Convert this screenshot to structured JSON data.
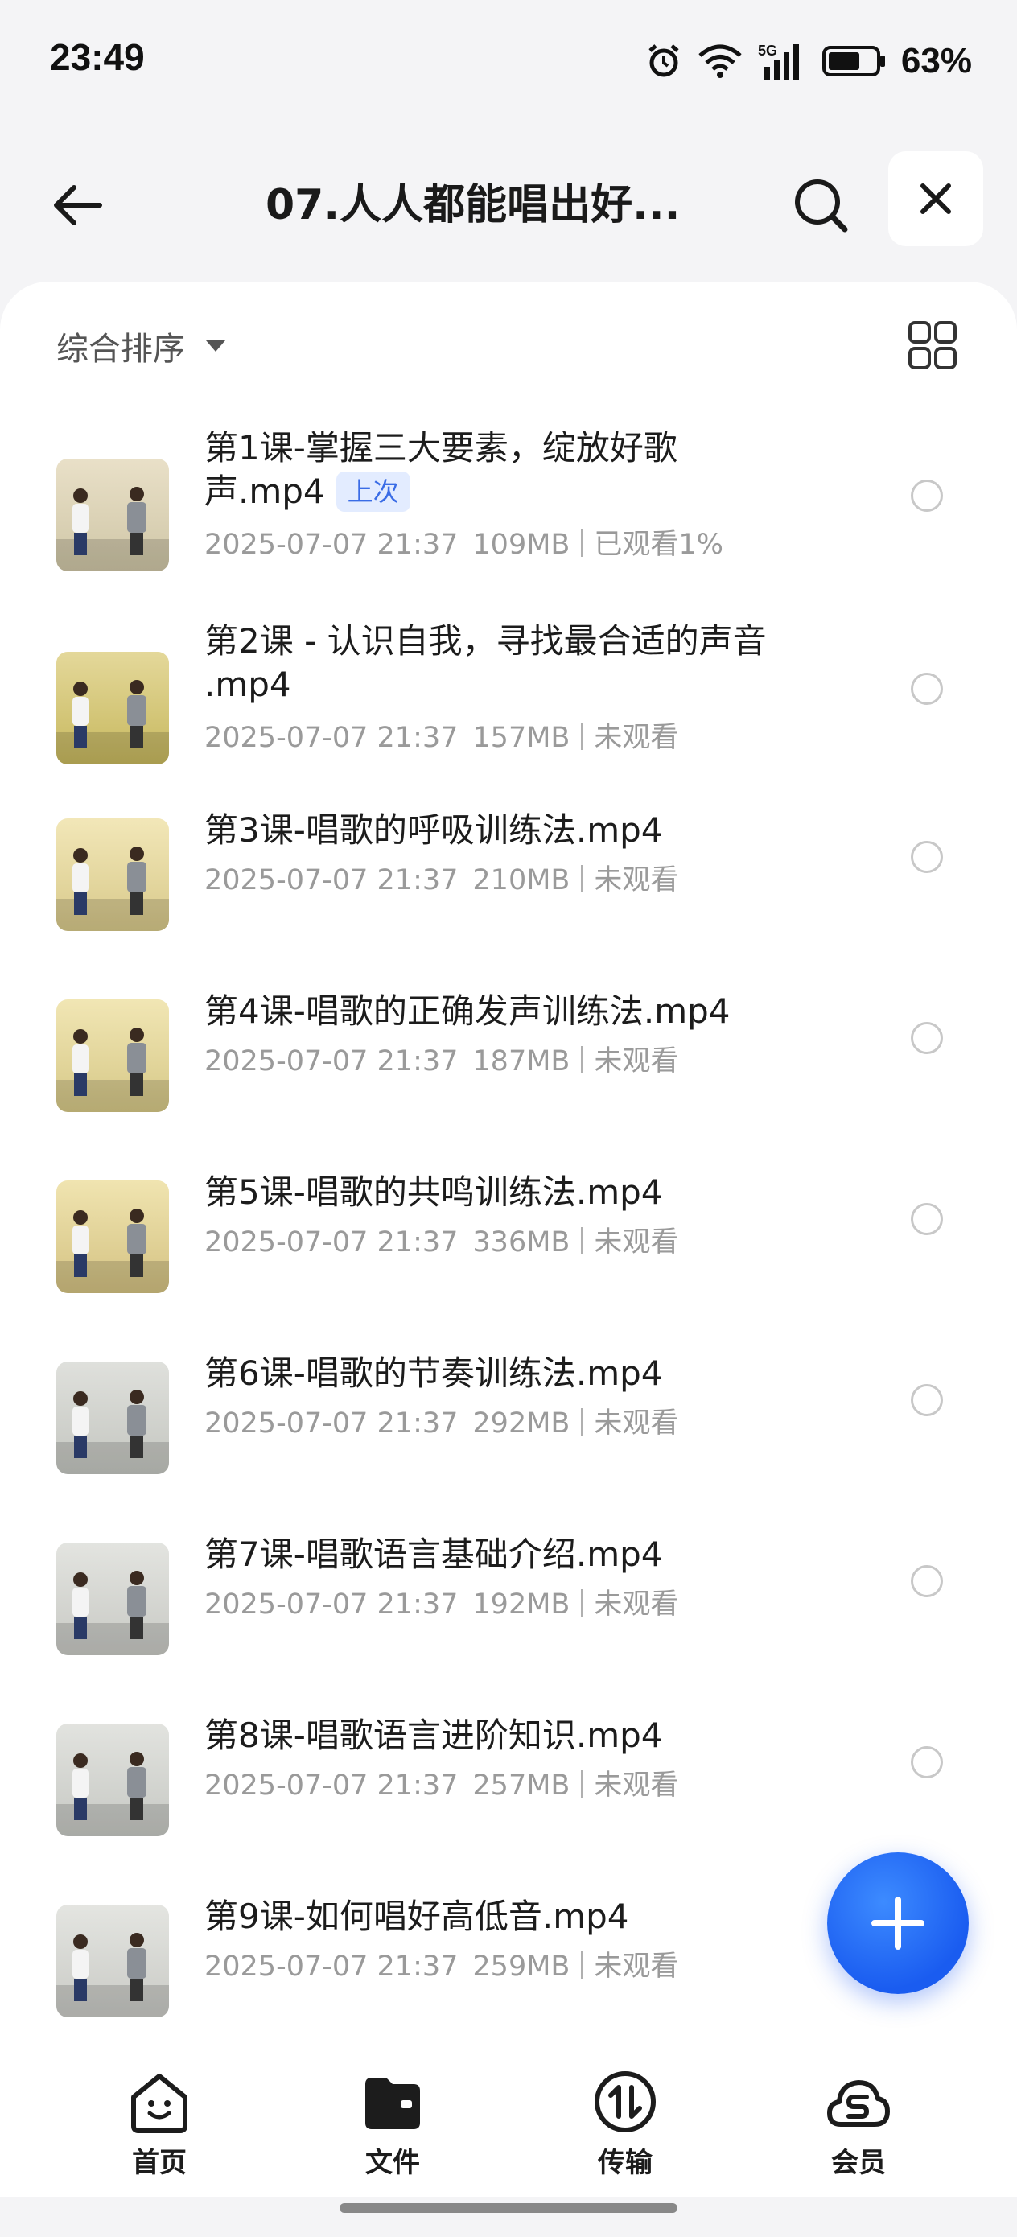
{
  "status_bar": {
    "time": "23:49",
    "battery": "63%",
    "network": "5G"
  },
  "nav": {
    "title": "07.人人都能唱出好...",
    "back_icon": "arrow-left-icon",
    "search_icon": "search-icon",
    "close_icon": "close-icon"
  },
  "toolbar": {
    "sort_label": "综合排序",
    "view_icon": "grid-view-icon"
  },
  "files": [
    {
      "name_line1": "第1课-掌握三大要素，绽放好歌",
      "name_line2": "声.mp4",
      "badge": "上次",
      "date": "2025-07-07 21:37",
      "size": "109MB",
      "status": "已观看1%"
    },
    {
      "name_line1": "第2课 - 认识自我，寻找最合适的声音",
      "name_line2": ".mp4",
      "badge": "",
      "date": "2025-07-07 21:37",
      "size": "157MB",
      "status": "未观看"
    },
    {
      "name_line1": "第3课-唱歌的呼吸训练法.mp4",
      "name_line2": "",
      "badge": "",
      "date": "2025-07-07 21:37",
      "size": "210MB",
      "status": "未观看"
    },
    {
      "name_line1": "第4课-唱歌的正确发声训练法.mp4",
      "name_line2": "",
      "badge": "",
      "date": "2025-07-07 21:37",
      "size": "187MB",
      "status": "未观看"
    },
    {
      "name_line1": "第5课-唱歌的共鸣训练法.mp4",
      "name_line2": "",
      "badge": "",
      "date": "2025-07-07 21:37",
      "size": "336MB",
      "status": "未观看"
    },
    {
      "name_line1": "第6课-唱歌的节奏训练法.mp4",
      "name_line2": "",
      "badge": "",
      "date": "2025-07-07 21:37",
      "size": "292MB",
      "status": "未观看"
    },
    {
      "name_line1": "第7课-唱歌语言基础介绍.mp4",
      "name_line2": "",
      "badge": "",
      "date": "2025-07-07 21:37",
      "size": "192MB",
      "status": "未观看"
    },
    {
      "name_line1": "第8课-唱歌语言进阶知识.mp4",
      "name_line2": "",
      "badge": "",
      "date": "2025-07-07 21:37",
      "size": "257MB",
      "status": "未观看"
    },
    {
      "name_line1": "第9课-如何唱好高低音.mp4",
      "name_line2": "",
      "badge": "",
      "date": "2025-07-07 21:37",
      "size": "259MB",
      "status": "未观看"
    }
  ],
  "fab": {
    "icon": "plus-icon"
  },
  "tabs": [
    {
      "label": "首页",
      "icon": "home-face-icon"
    },
    {
      "label": "文件",
      "icon": "folder-icon"
    },
    {
      "label": "传输",
      "icon": "transfer-icon"
    },
    {
      "label": "会员",
      "icon": "vip-cloud-icon"
    }
  ],
  "colors": {
    "accent": "#1a5cf0",
    "badge_bg": "#e3ecff",
    "badge_text": "#3a6ce6",
    "meta": "#9a9a9a"
  }
}
